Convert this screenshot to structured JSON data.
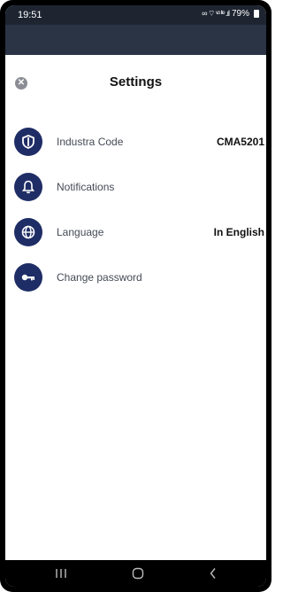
{
  "status_bar": {
    "time": "19:51",
    "indicators": "∞ ⌔ ᵛᵒ ˡᵗᵉ .ıl",
    "battery": "79%"
  },
  "sheet": {
    "title": "Settings",
    "close_icon": "close-icon"
  },
  "items": [
    {
      "label": "Industra Code",
      "value": "CMA5201",
      "icon": "shield-icon"
    },
    {
      "label": "Notifications",
      "value": "",
      "icon": "bell-icon"
    },
    {
      "label": "Language",
      "value": "In English",
      "icon": "globe-icon"
    },
    {
      "label": "Change password",
      "value": "",
      "icon": "key-icon"
    }
  ],
  "colors": {
    "icon_bg": "#1f2d66",
    "header_bg": "#2a3445",
    "status_bg": "#1e2531"
  },
  "nav": {
    "recent": "recent-apps-icon",
    "home": "home-icon",
    "back": "back-icon"
  }
}
